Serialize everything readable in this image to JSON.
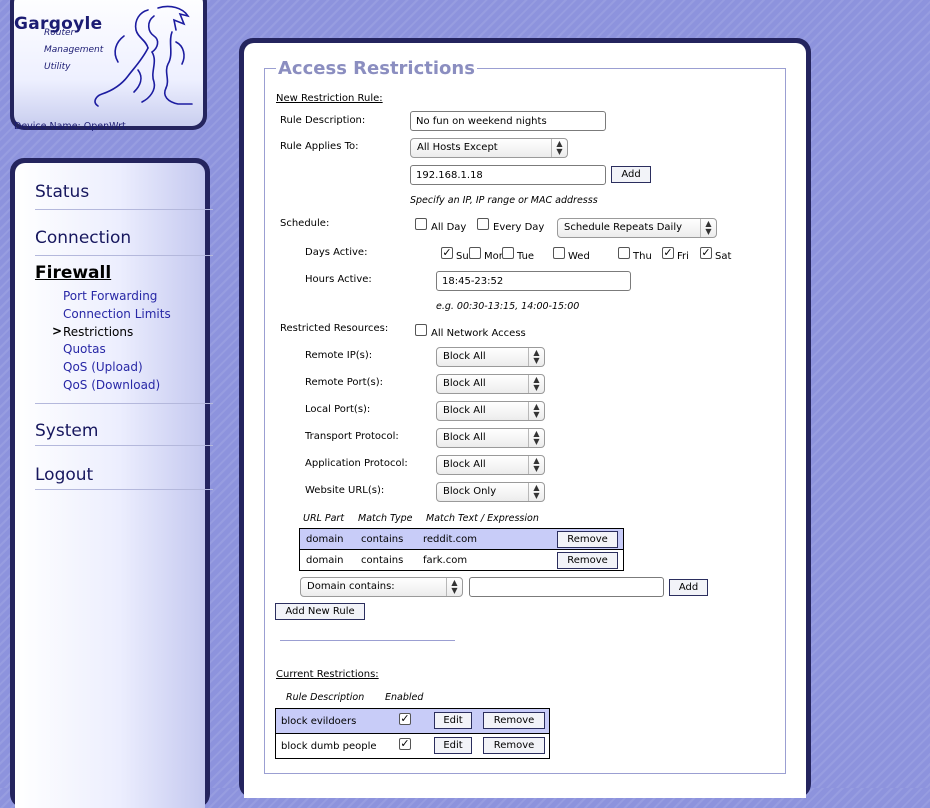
{
  "header": {
    "title": "Gargoyle",
    "subtitle_lines": [
      "Router",
      "Management",
      "Utility"
    ],
    "device_name_label": "Device Name:",
    "device_name": "OpenWrt"
  },
  "nav": {
    "status": "Status",
    "connection": "Connection",
    "firewall": "Firewall",
    "firewall_items": [
      "Port Forwarding",
      "Connection Limits",
      "Restrictions",
      "Quotas",
      "QoS (Upload)",
      "QoS (Download)"
    ],
    "current_marker": ">",
    "system": "System",
    "logout": "Logout"
  },
  "page": {
    "title": "Access Restrictions",
    "new_rule_heading": "New Restriction Rule:",
    "rule_description_label": "Rule Description:",
    "rule_description_value": "No fun on weekend nights",
    "applies_to_label": "Rule Applies To:",
    "applies_to_selected": "All Hosts Except",
    "host_input_value": "192.168.1.18",
    "add_label": "Add",
    "host_hint": "Specify an IP, IP range or MAC addresss",
    "schedule_label": "Schedule:",
    "all_day_label": "All Day",
    "every_day_label": "Every Day",
    "schedule_repeat_selected": "Schedule Repeats Daily",
    "days_active_label": "Days Active:",
    "days": [
      {
        "name": "Sun",
        "checked": true
      },
      {
        "name": "Mon",
        "checked": false
      },
      {
        "name": "Tue",
        "checked": false
      },
      {
        "name": "Wed",
        "checked": false
      },
      {
        "name": "Thu",
        "checked": false
      },
      {
        "name": "Fri",
        "checked": true
      },
      {
        "name": "Sat",
        "checked": true
      }
    ],
    "hours_active_label": "Hours Active:",
    "hours_active_value": "18:45-23:52",
    "hours_hint": "e.g. 00:30-13:15, 14:00-15:00",
    "restricted_resources_label": "Restricted Resources:",
    "all_network_access_label": "All Network Access",
    "resources": [
      {
        "label": "Remote IP(s):",
        "selected": "Block All"
      },
      {
        "label": "Remote Port(s):",
        "selected": "Block All"
      },
      {
        "label": "Local Port(s):",
        "selected": "Block All"
      },
      {
        "label": "Transport Protocol:",
        "selected": "Block All"
      },
      {
        "label": "Application Protocol:",
        "selected": "Block All"
      },
      {
        "label": "Website URL(s):",
        "selected": "Block Only"
      }
    ],
    "url_table": {
      "headers": [
        "URL Part",
        "Match Type",
        "Match Text / Expression"
      ],
      "rows": [
        {
          "part": "domain",
          "type": "contains",
          "text": "reddit.com",
          "action": "Remove"
        },
        {
          "part": "domain",
          "type": "contains",
          "text": "fark.com",
          "action": "Remove"
        }
      ]
    },
    "url_match_selected": "Domain contains:",
    "url_match_value": "",
    "url_add_label": "Add",
    "add_new_rule_label": "Add New Rule",
    "current_heading": "Current Restrictions:",
    "current_table": {
      "headers": [
        "Rule Description",
        "Enabled"
      ],
      "rows": [
        {
          "description": "block evildoers",
          "enabled": true,
          "edit": "Edit",
          "remove": "Remove"
        },
        {
          "description": "block dumb people",
          "enabled": true,
          "edit": "Edit",
          "remove": "Remove"
        }
      ]
    }
  },
  "colors": {
    "background": "#8d93dd",
    "frame": "#24245e",
    "title": "#8b8ec0",
    "nav_text": "#17175e",
    "nav_link": "#2828a6",
    "row_highlight": "#c8ccf8"
  }
}
